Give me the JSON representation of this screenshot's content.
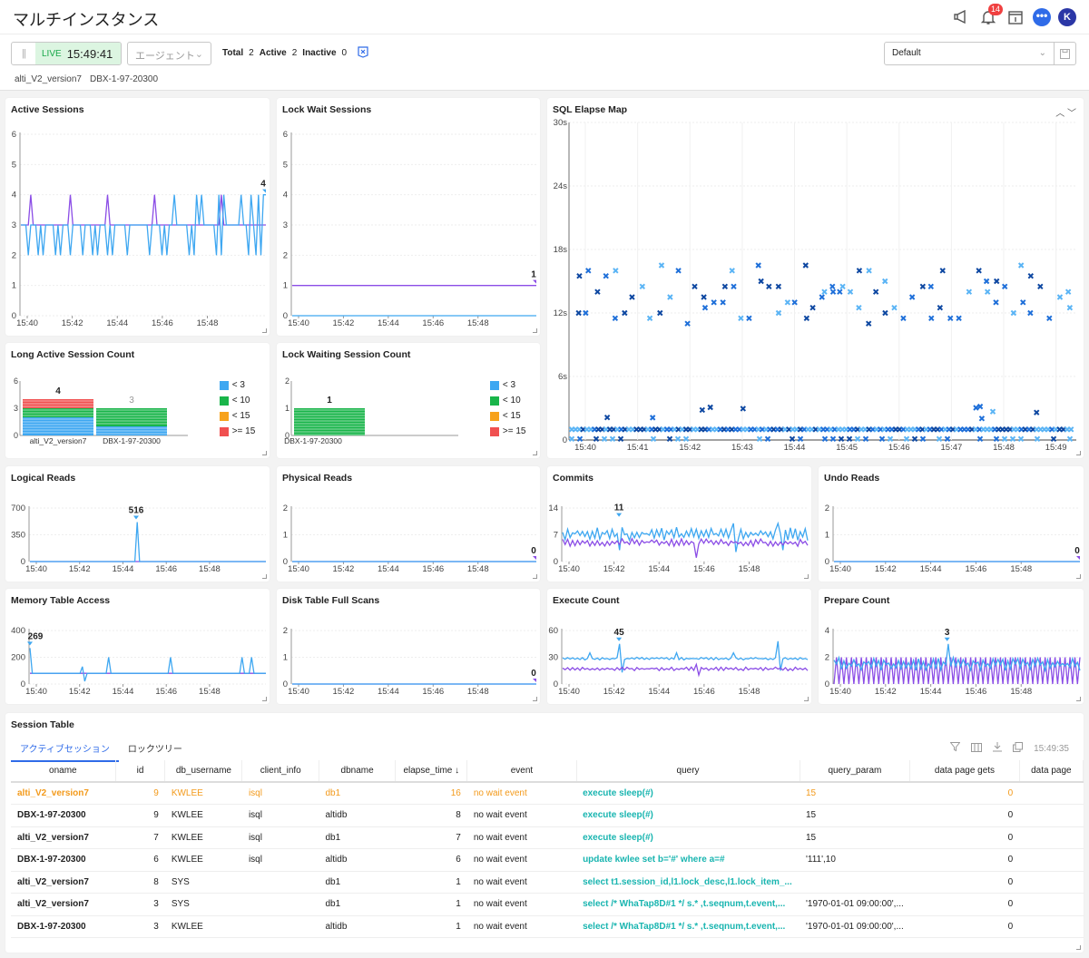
{
  "header": {
    "title": "マルチインスタンス",
    "notification_count": "14",
    "avatar_initial": "K",
    "chat_glyph": "•••"
  },
  "toolbar": {
    "pause_glyph": "||",
    "live_label": "LIVE",
    "live_time": "15:49:41",
    "agent_placeholder": "エージェント",
    "total_label": "Total",
    "total_value": "2",
    "active_label": "Active",
    "active_value": "2",
    "inactive_label": "Inactive",
    "inactive_value": "0",
    "instances": [
      "alti_V2_version7",
      "DBX-1-97-20300"
    ],
    "layout_select": "Default"
  },
  "colors": {
    "series_a": "#3ea7f1",
    "series_b": "#8b4de6",
    "accent": "#2f6be8",
    "live_green": "#19a84a",
    "highlight_row": "#f39a1b",
    "query_text": "#19b5b0",
    "bucket_lt3": "#3ea7f1",
    "bucket_lt10": "#19b54a",
    "bucket_lt15": "#f7a21b",
    "bucket_ge15": "#f05050"
  },
  "chart_data": [
    {
      "id": "active_sessions",
      "type": "line",
      "title": "Active Sessions",
      "ylim": [
        0,
        6
      ],
      "yticks": [
        "0",
        "1",
        "2",
        "3",
        "4",
        "5",
        "6"
      ],
      "xticks": [
        "15:40",
        "15:42",
        "15:44",
        "15:46",
        "15:48"
      ],
      "last_label": "4",
      "series": [
        {
          "name": "alti_V2_version7",
          "color": "#8b4de6",
          "values": [
            3,
            3,
            3,
            3,
            4,
            3,
            3,
            3,
            3,
            3,
            3,
            3,
            3,
            3,
            3,
            3,
            3,
            3,
            3,
            3,
            4,
            3,
            3,
            3,
            3,
            3,
            3,
            3,
            3,
            3,
            3,
            3,
            3,
            3,
            3,
            4,
            3,
            3,
            3,
            3,
            3,
            3,
            3,
            3,
            3,
            3,
            3,
            3,
            3,
            3,
            3,
            3,
            3,
            3,
            4,
            3,
            3,
            3,
            3,
            3,
            3,
            3,
            3,
            3,
            3,
            3,
            3,
            3,
            3,
            3,
            3,
            3,
            3,
            3,
            3,
            3,
            3,
            3,
            3,
            3,
            3,
            4,
            3,
            3,
            3,
            3,
            3,
            3,
            3,
            3,
            3,
            3,
            3,
            3,
            3,
            3,
            3,
            3,
            3,
            3
          ]
        },
        {
          "name": "DBX-1-97-20300",
          "color": "#3ea7f1",
          "values": [
            3,
            3,
            3,
            2,
            3,
            3,
            3,
            2,
            3,
            2,
            3,
            3,
            3,
            3,
            2,
            3,
            2,
            3,
            3,
            3,
            2,
            3,
            3,
            3,
            3,
            2,
            3,
            3,
            3,
            2,
            3,
            2,
            3,
            3,
            3,
            2,
            3,
            2,
            3,
            3,
            3,
            3,
            3,
            2,
            3,
            3,
            3,
            3,
            3,
            3,
            3,
            3,
            2,
            3,
            3,
            3,
            3,
            2,
            3,
            2,
            3,
            3,
            4,
            3,
            3,
            3,
            3,
            3,
            2,
            3,
            2,
            4,
            3,
            4,
            3,
            3,
            3,
            3,
            3,
            2,
            4,
            2,
            4,
            3,
            3,
            3,
            3,
            3,
            3,
            4,
            3,
            3,
            2,
            4,
            3,
            2,
            4,
            2,
            4,
            4
          ]
        }
      ]
    },
    {
      "id": "lock_wait_sessions",
      "type": "line",
      "title": "Lock Wait Sessions",
      "ylim": [
        0,
        6
      ],
      "yticks": [
        "0",
        "1",
        "2",
        "3",
        "4",
        "5",
        "6"
      ],
      "xticks": [
        "15:40",
        "15:42",
        "15:44",
        "15:46",
        "15:48"
      ],
      "last_label": "1",
      "series": [
        {
          "name": "alti_V2_version7",
          "color": "#8b4de6",
          "values": [
            1,
            1
          ]
        },
        {
          "name": "DBX-1-97-20300",
          "color": "#3ea7f1",
          "values": [
            0,
            0
          ]
        }
      ]
    },
    {
      "id": "sql_elapse_map",
      "type": "scatter",
      "title": "SQL Elapse Map",
      "ylim": [
        0,
        30
      ],
      "yticks": [
        "0",
        "6s",
        "12s",
        "18s",
        "24s",
        "30s"
      ],
      "xticks": [
        "15:40",
        "15:41",
        "15:42",
        "15:43",
        "15:44",
        "15:45",
        "15:46",
        "15:47",
        "15:48",
        "15:49"
      ],
      "description": "Dense band of points near 0-1s across the whole range; cluster of points between 11s and 16s; sparse points near 2-3s",
      "bands_seconds": [
        [
          0,
          1.2
        ],
        [
          10.5,
          16.5
        ]
      ]
    },
    {
      "id": "long_active_session_count",
      "type": "bar",
      "title": "Long Active Session Count",
      "ylim": [
        0,
        6
      ],
      "yticks": [
        "0",
        "3",
        "6"
      ],
      "categories": [
        "alti_V2_version7",
        "DBX-1-97-20300"
      ],
      "totals": [
        "4",
        "3"
      ],
      "series": [
        {
          "name": "< 3",
          "values": [
            2,
            1
          ]
        },
        {
          "name": "< 10",
          "values": [
            1,
            2
          ]
        },
        {
          "name": "< 15",
          "values": [
            0,
            0
          ]
        },
        {
          "name": ">= 15",
          "values": [
            1,
            0
          ]
        }
      ]
    },
    {
      "id": "lock_waiting_session_count",
      "type": "bar",
      "title": "Lock Waiting Session Count",
      "ylim": [
        0,
        2
      ],
      "yticks": [
        "0",
        "1",
        "2"
      ],
      "categories": [
        "DBX-1-97-20300"
      ],
      "totals": [
        "1"
      ],
      "series": [
        {
          "name": "< 3",
          "values": [
            0
          ]
        },
        {
          "name": "< 10",
          "values": [
            1
          ]
        },
        {
          "name": "< 15",
          "values": [
            0
          ]
        },
        {
          "name": ">= 15",
          "values": [
            0
          ]
        }
      ]
    },
    {
      "id": "logical_reads",
      "type": "line",
      "title": "Logical Reads",
      "ylim": [
        0,
        700
      ],
      "yticks": [
        "0",
        "350",
        "700"
      ],
      "xticks": [
        "15:40",
        "15:42",
        "15:44",
        "15:46",
        "15:48"
      ],
      "peak": {
        "label": "516",
        "at": 0.45,
        "value": 516
      },
      "series": [
        {
          "name": "alti_V2_version7",
          "color": "#8b4de6",
          "flat": 0
        },
        {
          "name": "DBX-1-97-20300",
          "color": "#3ea7f1",
          "flat": 0,
          "spikes": [
            [
              0.45,
              516
            ]
          ]
        }
      ]
    },
    {
      "id": "physical_reads",
      "type": "line",
      "title": "Physical Reads",
      "ylim": [
        0,
        2
      ],
      "yticks": [
        "0",
        "1",
        "2"
      ],
      "xticks": [
        "15:40",
        "15:42",
        "15:44",
        "15:46",
        "15:48"
      ],
      "last_label": "0",
      "series": [
        {
          "name": "alti_V2_version7",
          "color": "#8b4de6",
          "flat": 0
        },
        {
          "name": "DBX-1-97-20300",
          "color": "#3ea7f1",
          "flat": 0
        }
      ]
    },
    {
      "id": "commits",
      "type": "line",
      "title": "Commits",
      "ylim": [
        0,
        14
      ],
      "yticks": [
        "0",
        "7",
        "14"
      ],
      "xticks": [
        "15:40",
        "15:42",
        "15:44",
        "15:46",
        "15:48"
      ],
      "peak": {
        "label": "11",
        "at": 0.23,
        "value": 11
      },
      "series": [
        {
          "name": "DBX-1-97-20300",
          "color": "#3ea7f1",
          "noise": [
            5.5,
            9
          ],
          "spikes": [
            [
              0.23,
              11
            ],
            [
              0.23,
              3
            ],
            [
              0.71,
              2.5
            ],
            [
              0.7,
              10
            ],
            [
              0.88,
              10
            ],
            [
              0.9,
              3
            ]
          ]
        },
        {
          "name": "alti_V2_version7",
          "color": "#8b4de6",
          "noise": [
            4,
            6
          ],
          "spikes": [
            [
              0.55,
              1
            ]
          ]
        }
      ]
    },
    {
      "id": "undo_reads",
      "type": "line",
      "title": "Undo Reads",
      "ylim": [
        0,
        2
      ],
      "yticks": [
        "0",
        "1",
        "2"
      ],
      "xticks": [
        "15:40",
        "15:42",
        "15:44",
        "15:46",
        "15:48"
      ],
      "last_label": "0",
      "series": [
        {
          "name": "alti_V2_version7",
          "color": "#8b4de6",
          "flat": 0
        },
        {
          "name": "DBX-1-97-20300",
          "color": "#3ea7f1",
          "flat": 0
        }
      ]
    },
    {
      "id": "memory_table_access",
      "type": "line",
      "title": "Memory Table Access",
      "ylim": [
        0,
        400
      ],
      "yticks": [
        "0",
        "200",
        "400"
      ],
      "xticks": [
        "15:40",
        "15:42",
        "15:44",
        "15:46",
        "15:48"
      ],
      "peak": {
        "label": "269",
        "at": 0.0,
        "value": 269
      },
      "series": [
        {
          "name": "alti_V2_version7",
          "color": "#8b4de6",
          "flat": 80
        },
        {
          "name": "DBX-1-97-20300",
          "color": "#3ea7f1",
          "flat": 80,
          "spikes": [
            [
              0.0,
              269
            ],
            [
              0.22,
              130
            ],
            [
              0.23,
              20
            ],
            [
              0.33,
              200
            ],
            [
              0.6,
              200
            ],
            [
              0.9,
              200
            ],
            [
              0.94,
              200
            ]
          ]
        }
      ]
    },
    {
      "id": "disk_table_full_scans",
      "type": "line",
      "title": "Disk Table Full Scans",
      "ylim": [
        0,
        2
      ],
      "yticks": [
        "0",
        "1",
        "2"
      ],
      "xticks": [
        "15:40",
        "15:42",
        "15:44",
        "15:46",
        "15:48"
      ],
      "last_label": "0",
      "series": [
        {
          "name": "alti_V2_version7",
          "color": "#8b4de6",
          "flat": 0
        },
        {
          "name": "DBX-1-97-20300",
          "color": "#3ea7f1",
          "flat": 0
        }
      ]
    },
    {
      "id": "execute_count",
      "type": "line",
      "title": "Execute Count",
      "ylim": [
        0,
        60
      ],
      "yticks": [
        "0",
        "30",
        "60"
      ],
      "xticks": [
        "15:40",
        "15:42",
        "15:44",
        "15:46",
        "15:48"
      ],
      "peak": {
        "label": "45",
        "at": 0.23,
        "value": 45
      },
      "series": [
        {
          "name": "DBX-1-97-20300",
          "color": "#3ea7f1",
          "noise": [
            27,
            30
          ],
          "spikes": [
            [
              0.11,
              35
            ],
            [
              0.23,
              45
            ],
            [
              0.24,
              13
            ],
            [
              0.46,
              35
            ],
            [
              0.7,
              35
            ],
            [
              0.88,
              48
            ],
            [
              0.89,
              15
            ]
          ]
        },
        {
          "name": "alti_V2_version7",
          "color": "#8b4de6",
          "noise": [
            15,
            19
          ],
          "spikes": [
            [
              0.55,
              22
            ],
            [
              0.56,
              10
            ]
          ]
        }
      ]
    },
    {
      "id": "prepare_count",
      "type": "line",
      "title": "Prepare Count",
      "ylim": [
        0,
        4
      ],
      "yticks": [
        "0",
        "2",
        "4"
      ],
      "xticks": [
        "15:40",
        "15:42",
        "15:44",
        "15:46",
        "15:48"
      ],
      "peak": {
        "label": "3",
        "at": 0.46,
        "value": 3
      },
      "series": [
        {
          "name": "alti_V2_version7",
          "color": "#8b4de6",
          "alternate": [
            0,
            2
          ]
        },
        {
          "name": "DBX-1-97-20300",
          "color": "#3ea7f1",
          "noise": [
            1,
            2
          ],
          "spikes": [
            [
              0.46,
              3
            ]
          ]
        }
      ]
    }
  ],
  "legend_buckets": [
    "< 3",
    "< 10",
    "< 15",
    ">= 15"
  ],
  "session_table": {
    "title": "Session Table",
    "tabs": [
      "アクティブセッション",
      "ロックツリー"
    ],
    "updated_time": "15:49:35",
    "columns": [
      "oname",
      "id",
      "db_username",
      "client_info",
      "dbname",
      "elapse_time ↓",
      "event",
      "query",
      "query_param",
      "data page gets",
      "data page"
    ],
    "rows": [
      {
        "oname": "alti_V2_version7",
        "id": "9",
        "db_username": "KWLEE",
        "client_info": "isql",
        "dbname": "db1",
        "elapse_time": "16",
        "event": "no wait event",
        "query": "execute sleep(#)",
        "query_param": "15",
        "data_page_gets": "0",
        "highlight": true
      },
      {
        "oname": "DBX-1-97-20300",
        "id": "9",
        "db_username": "KWLEE",
        "client_info": "isql",
        "dbname": "altidb",
        "elapse_time": "8",
        "event": "no wait event",
        "query": "execute sleep(#)",
        "query_param": "15",
        "data_page_gets": "0"
      },
      {
        "oname": "alti_V2_version7",
        "id": "7",
        "db_username": "KWLEE",
        "client_info": "isql",
        "dbname": "db1",
        "elapse_time": "7",
        "event": "no wait event",
        "query": "execute sleep(#)",
        "query_param": "15",
        "data_page_gets": "0"
      },
      {
        "oname": "DBX-1-97-20300",
        "id": "6",
        "db_username": "KWLEE",
        "client_info": "isql",
        "dbname": "altidb",
        "elapse_time": "6",
        "event": "no wait event",
        "query": "update kwlee set b='#' where a=#",
        "query_param": "'111',10",
        "data_page_gets": "0"
      },
      {
        "oname": "alti_V2_version7",
        "id": "8",
        "db_username": "SYS",
        "client_info": "",
        "dbname": "db1",
        "elapse_time": "1",
        "event": "no wait event",
        "query": "select t1.session_id,l1.lock_desc,l1.lock_item_...",
        "query_param": "",
        "data_page_gets": "0"
      },
      {
        "oname": "alti_V2_version7",
        "id": "3",
        "db_username": "SYS",
        "client_info": "",
        "dbname": "db1",
        "elapse_time": "1",
        "event": "no wait event",
        "query": "select /* WhaTap8D#1 */ s.* ,t.seqnum,t.event,...",
        "query_param": "'1970-01-01 09:00:00',...",
        "data_page_gets": "0"
      },
      {
        "oname": "DBX-1-97-20300",
        "id": "3",
        "db_username": "KWLEE",
        "client_info": "",
        "dbname": "altidb",
        "elapse_time": "1",
        "event": "no wait event",
        "query": "select /* WhaTap8D#1 */ s.* ,t.seqnum,t.event,...",
        "query_param": "'1970-01-01 09:00:00',...",
        "data_page_gets": "0"
      }
    ]
  }
}
